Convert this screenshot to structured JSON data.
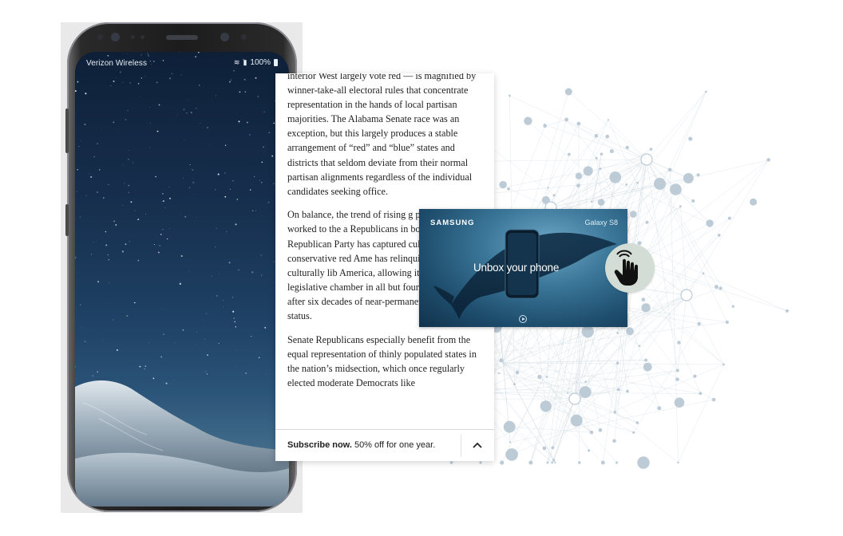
{
  "phone": {
    "carrier": "Verizon Wireless",
    "battery": "100%",
    "signal_glyph": "signal-icon",
    "wifi_glyph": "wifi-icon"
  },
  "article": {
    "paragraphs": [
      "interior West largely vote red — is magnified by winner-take-all electoral rules that concentrate representation in the hands of local partisan majorities. The Alabama Senate race was an exception, but this largely produces a stable arrangement of “red” and “blue” states and districts that seldom deviate from their normal partisan alignments regardless of the individual candidates seeking office.",
      "On balance, the trend of rising g polarization has worked to the a Republicans in both houses of C Republican Party has captured culturally conservative red Ame has relinquished in culturally lib America, allowing it to control a legislative chamber in all but four years since 1994 after six decades of near-permanent minority status.",
      "Senate Republicans especially benefit from the equal representation of thinly populated states in the nation’s midsection, which once regularly elected moderate Democrats like"
    ],
    "subscribe": {
      "bold": "Subscribe now.",
      "rest": " 50% off for one year."
    }
  },
  "ad": {
    "brand": "SAMSUNG",
    "product": "Galaxy S8",
    "headline": "Unbox your phone"
  },
  "colors": {
    "network_node": "#bccbd6",
    "network_line": "#c9d6de",
    "ad_bg": "#2d6a8d",
    "hand_circle": "#d3ddd6"
  }
}
